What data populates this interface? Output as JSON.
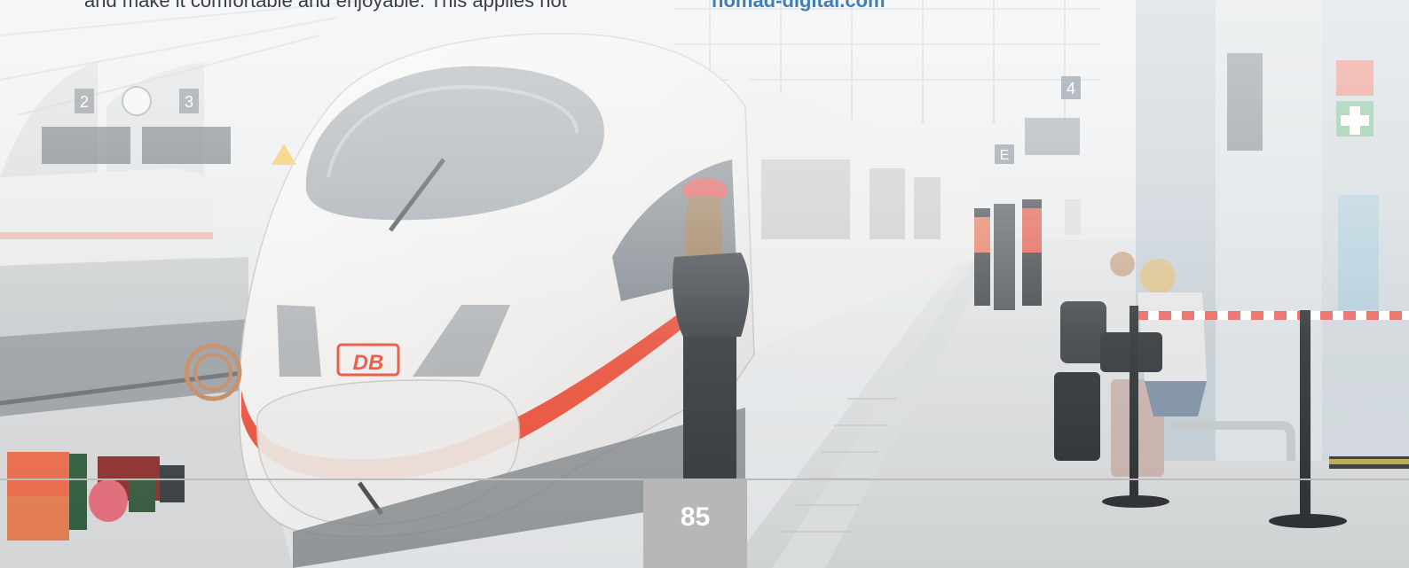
{
  "article": {
    "text_line": "and make it comfortable and enjoyable. This applies not",
    "url": "nomad-digital.com"
  },
  "photo": {
    "description_icon": "train-photo",
    "train_logo": "DB",
    "platform_numbers": [
      "2",
      "3",
      "4"
    ]
  },
  "footer": {
    "page_number": "85"
  },
  "colors": {
    "link": "#3f7fb8",
    "page_box": "#b8b7b7",
    "train_stripe": "#e8503a"
  }
}
